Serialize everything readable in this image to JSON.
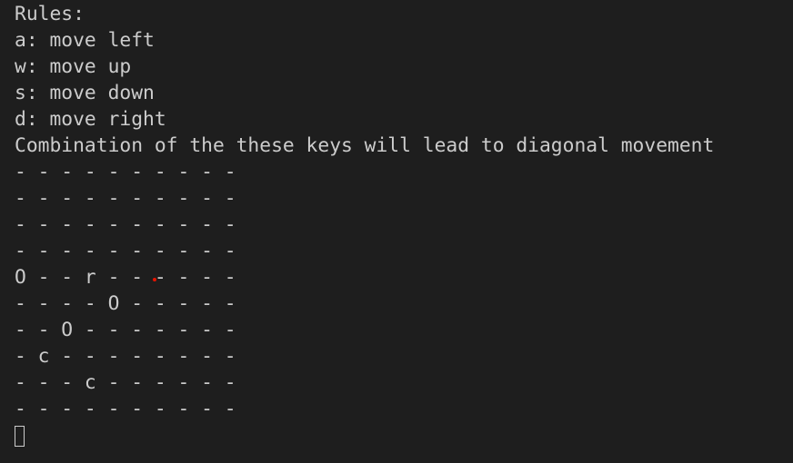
{
  "terminal": {
    "lines": [
      "Rules:",
      "a: move left",
      "w: move up",
      "s: move down",
      "d: move right",
      "Combination of the these keys will lead to diagonal movement",
      "- - - - - - - - - -",
      "- - - - - - - - - -",
      "- - - - - - - - - -",
      "- - - - - - - - - -",
      "O - - r - - - - - -",
      "- - - - O - - - - -",
      "- - O - - - - - - -",
      "- c - - - - - - - -",
      "- - - c - - - - - -",
      "- - - - - - - - - -"
    ]
  },
  "colors": {
    "background": "#1e1e1e",
    "foreground": "#cccccc",
    "marker": "#e51400"
  }
}
